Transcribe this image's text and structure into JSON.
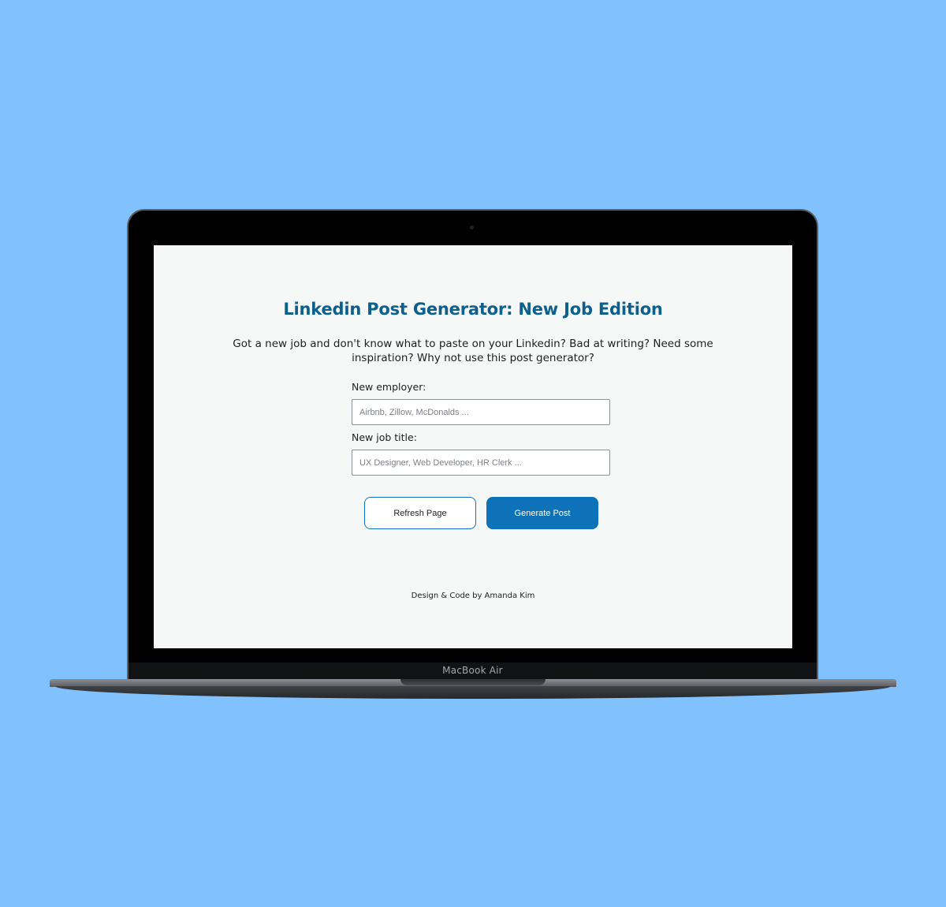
{
  "device": {
    "model_label": "MacBook Air"
  },
  "page": {
    "title": "Linkedin Post Generator: New Job Edition",
    "intro": "Got a new job and don't know what to paste on your Linkedin? Bad at writing? Need some inspiration? Why not use this post generator?"
  },
  "form": {
    "employer": {
      "label": "New employer:",
      "value": "",
      "placeholder": "Airbnb, Zillow, McDonalds ..."
    },
    "job_title": {
      "label": "New job title:",
      "value": "",
      "placeholder": "UX Designer, Web Developer, HR Clerk ..."
    }
  },
  "buttons": {
    "refresh_label": "Refresh Page",
    "generate_label": "Generate Post"
  },
  "footer": {
    "credit": "Design & Code by Amanda Kim"
  },
  "colors": {
    "background": "#81c1fe",
    "title": "#0d5f8c",
    "primary_button": "#0d72b8",
    "screen_background": "#f6f8f7"
  }
}
